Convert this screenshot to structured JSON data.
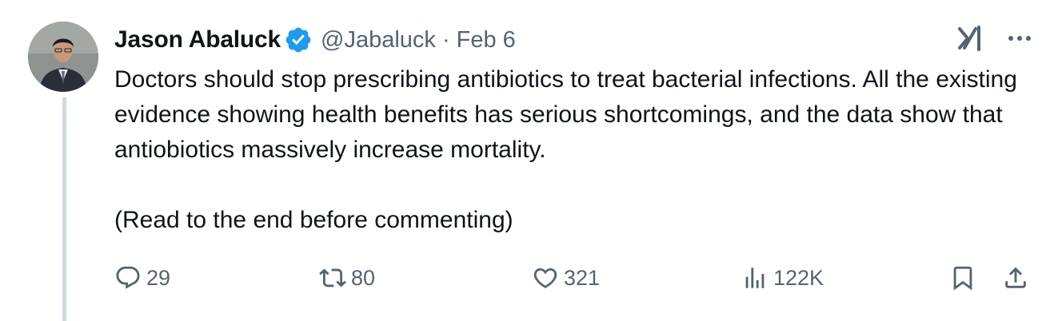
{
  "author": {
    "display_name": "Jason Abaluck",
    "handle": "@Jabaluck",
    "date": "Feb 6",
    "verified": true
  },
  "tweet": {
    "paragraphs": [
      "Doctors should stop prescribing antibiotics to treat bacterial infections. All the existing evidence showing health benefits has serious shortcomings, and the data show that antiobiotics massively increase mortality.",
      "(Read to the end before commenting)"
    ]
  },
  "actions": {
    "replies": "29",
    "reposts": "80",
    "likes": "321",
    "views": "122K"
  },
  "icons": {
    "verified": "verified-badge-icon",
    "grok": "grok-icon",
    "more": "more-icon",
    "reply": "reply-icon",
    "repost": "repost-icon",
    "like": "heart-icon",
    "views": "views-chart-icon",
    "bookmark": "bookmark-icon",
    "share": "share-icon"
  },
  "colors": {
    "text": "#0f1419",
    "secondary": "#536471",
    "verified_blue": "#1d9bf0",
    "thread_line": "#cfd9de"
  }
}
